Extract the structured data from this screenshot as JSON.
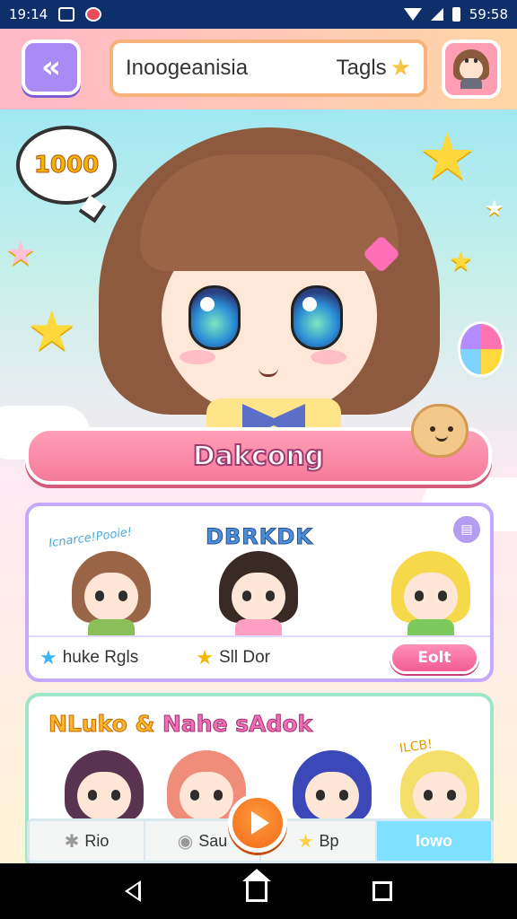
{
  "status_bar": {
    "time": "19:14",
    "right_time": "59:58"
  },
  "header": {
    "back_icon": "double-chevron-left",
    "title": "Inoogeanisia",
    "tags_label": "Tagls",
    "profile_icon": "avatar"
  },
  "hero": {
    "speech_value": "1000",
    "character_name": "Dakcong"
  },
  "card1": {
    "handwritten": "Icnarce!Pooie!",
    "heading": "DBRKDK",
    "tag1": "huke Rgls",
    "tag2": "Sll Dor",
    "edit_button": "Eolt"
  },
  "card2": {
    "heading_part1": "NLuko & ",
    "heading_part2": "Nahe sAdok",
    "handwritten": "ILCB!"
  },
  "bottom_nav": {
    "items": [
      {
        "label": "Rio",
        "icon": "puzzle-icon"
      },
      {
        "label": "Sau",
        "icon": "chat-icon"
      },
      {
        "label": "Bp",
        "icon": "star-icon"
      },
      {
        "label": "Iowo",
        "icon": ""
      }
    ]
  },
  "colors": {
    "accent_purple": "#a98bf5",
    "accent_pink": "#f57a9a",
    "accent_orange": "#f26a17",
    "accent_cyan": "#7fe0ff"
  }
}
